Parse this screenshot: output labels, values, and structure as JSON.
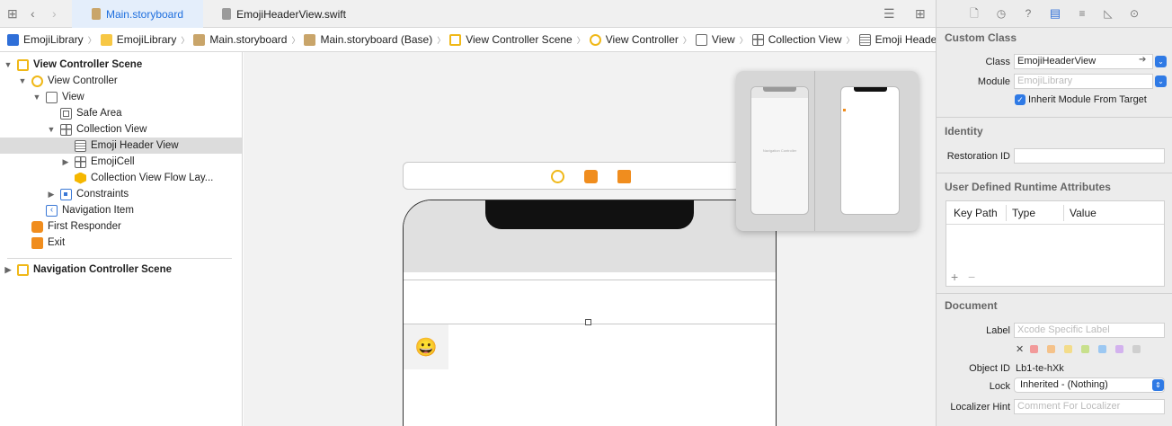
{
  "tabs": [
    {
      "label": "Main.storyboard",
      "active": true
    },
    {
      "label": "EmojiHeaderView.swift",
      "active": false
    }
  ],
  "breadcrumb": [
    {
      "label": "EmojiLibrary",
      "icon": "project-icon"
    },
    {
      "label": "EmojiLibrary",
      "icon": "folder-icon"
    },
    {
      "label": "Main.storyboard",
      "icon": "storyboard-icon"
    },
    {
      "label": "Main.storyboard (Base)",
      "icon": "storyboard-icon"
    },
    {
      "label": "View Controller Scene",
      "icon": "scene-icon"
    },
    {
      "label": "View Controller",
      "icon": "view-controller-icon"
    },
    {
      "label": "View",
      "icon": "view-icon"
    },
    {
      "label": "Collection View",
      "icon": "collection-view-icon"
    },
    {
      "label": "Emoji Header View",
      "icon": "header-view-icon"
    }
  ],
  "outline": {
    "items": [
      {
        "label": "View Controller Scene",
        "icon": "scene-icon",
        "level": 0,
        "disclosure": "open",
        "bold": true
      },
      {
        "label": "View Controller",
        "icon": "view-controller-icon",
        "level": 1,
        "disclosure": "open"
      },
      {
        "label": "View",
        "icon": "view-icon",
        "level": 2,
        "disclosure": "open"
      },
      {
        "label": "Safe Area",
        "icon": "safe-area-icon",
        "level": 3,
        "disclosure": "none"
      },
      {
        "label": "Collection View",
        "icon": "collection-view-icon",
        "level": 3,
        "disclosure": "open"
      },
      {
        "label": "Emoji Header View",
        "icon": "header-view-icon",
        "level": 4,
        "disclosure": "none",
        "selected": true
      },
      {
        "label": "EmojiCell",
        "icon": "collection-view-icon",
        "level": 4,
        "disclosure": "closed"
      },
      {
        "label": "Collection View Flow Lay...",
        "icon": "flow-layout-icon",
        "level": 4,
        "disclosure": "none"
      },
      {
        "label": "Constraints",
        "icon": "constraints-icon",
        "level": 3,
        "disclosure": "closed"
      },
      {
        "label": "Navigation Item",
        "icon": "navigation-item-icon",
        "level": 2,
        "disclosure": "none"
      },
      {
        "label": "First Responder",
        "icon": "first-responder-icon",
        "level": 1,
        "disclosure": "none"
      },
      {
        "label": "Exit",
        "icon": "exit-icon",
        "level": 1,
        "disclosure": "none"
      }
    ],
    "scene2": {
      "label": "Navigation Controller Scene",
      "icon": "scene-icon",
      "disclosure": "closed"
    }
  },
  "canvas": {
    "emoji": "😀",
    "minimap_label": "Navigation Controller"
  },
  "inspector": {
    "custom_class": {
      "title": "Custom Class",
      "class_label": "Class",
      "class_value": "EmojiHeaderView",
      "module_label": "Module",
      "module_placeholder": "EmojiLibrary",
      "inherit_label": "Inherit Module From Target",
      "inherit_checked": true
    },
    "identity": {
      "title": "Identity",
      "restoration_label": "Restoration ID",
      "restoration_value": ""
    },
    "runtime_attributes": {
      "title": "User Defined Runtime Attributes",
      "columns": [
        "Key Path",
        "Type",
        "Value"
      ],
      "add": "+",
      "remove": "−"
    },
    "document": {
      "title": "Document",
      "label_label": "Label",
      "label_placeholder": "Xcode Specific Label",
      "clear_glyph": "✕",
      "swatches": [
        "#f29a9a",
        "#f5c28a",
        "#f3dc8a",
        "#c8e08c",
        "#9cc8f2",
        "#d3b2ee",
        "#cfcfcf"
      ],
      "object_id_label": "Object ID",
      "object_id_value": "Lb1-te-hXk",
      "lock_label": "Lock",
      "lock_value": "Inherited - (Nothing)",
      "localizer_label": "Localizer Hint",
      "localizer_placeholder": "Comment For Localizer"
    }
  },
  "colors": {
    "accent": "#2f7ae5",
    "selection": "#dcdcdc",
    "scene": "#f0b818"
  }
}
